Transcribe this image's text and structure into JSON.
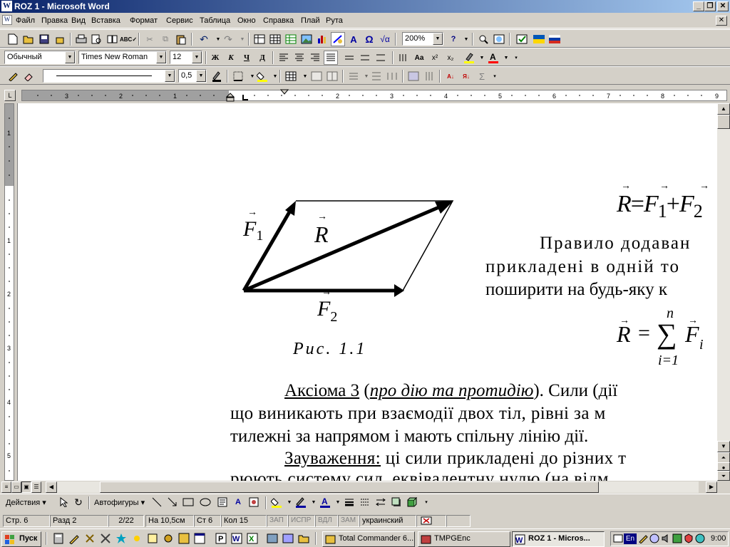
{
  "window": {
    "title": "ROZ 1 - Microsoft Word",
    "icon_text": "W"
  },
  "menu": [
    "Файл",
    "Правка",
    "Вид",
    "Вставка",
    "Формат",
    "Сервис",
    "Таблица",
    "Окно",
    "Справка",
    "Плай",
    "Рута"
  ],
  "menu_underline": [
    "Ф",
    "П",
    "В",
    "а",
    "о",
    "С",
    "Т",
    "О",
    "С",
    "",
    "Р"
  ],
  "toolbar": {
    "zoom": "200%",
    "style": "Обычный",
    "font": "Times New Roman",
    "size": "12",
    "line_weight": "0,5"
  },
  "document": {
    "figure_labels": {
      "F1": "F",
      "F1_sub": "1",
      "R": "R",
      "F2": "F",
      "F2_sub": "2",
      "caption": "Рис. 1.1"
    },
    "formula1": {
      "R": "R",
      "eq": "=",
      "F1": "F",
      "sub1": "1",
      "plus": "+",
      "F2": "F",
      "sub2": "2"
    },
    "para1_line1": "Правило додаван",
    "para1_line2": "прикладені в одній то",
    "para1_line3": "поширити на будь-яку к",
    "formula2": {
      "R": "R",
      "eq": "=",
      "sum": "∑",
      "upper": "n",
      "lower": "i=1",
      "F": "F",
      "sub": "i"
    },
    "axiom_title": "Аксіома 3",
    "axiom_paren_open": " (",
    "axiom_italic": "про дію та протидію",
    "axiom_rest": "). Сили (дії",
    "line2": "що виникають при взаємодії двох тіл, рівні за м",
    "line3": "тилежні за напрямом і мають спільну лінію дії.",
    "note_title": "Зауваження:",
    "note_rest": " ці сили прикладені до різних т",
    "line5": "рюють систему сил, еквівалентну нулю (на відм"
  },
  "drawing": {
    "actions": "Действия",
    "autoshapes": "Автофигуры"
  },
  "status": {
    "page": "Стр. 6",
    "section": "Разд 2",
    "pages": "2/22",
    "at": "На 10,5см",
    "line": "Ст 6",
    "col": "Кол 15",
    "rec": "ЗАП",
    "trk": "ИСПР",
    "ext": "ВДЛ",
    "ovr": "ЗАМ",
    "lang": "украинский"
  },
  "taskbar": {
    "start": "Пуск",
    "tasks": [
      "Total Commander 6...",
      "TMPGEnc",
      "ROZ 1 - Micros..."
    ],
    "clock": "9:00",
    "lang": "En"
  }
}
